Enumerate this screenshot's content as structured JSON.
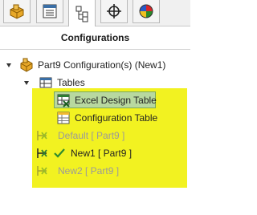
{
  "tabs": [
    {
      "name": "featuremanager-tab",
      "icon": "part-icon"
    },
    {
      "name": "propertymanager-tab",
      "icon": "property-list-icon"
    },
    {
      "name": "configurationmanager-tab",
      "icon": "configuration-tree-icon"
    },
    {
      "name": "dimxpertmanager-tab",
      "icon": "crosshair-icon"
    },
    {
      "name": "displaymanager-tab",
      "icon": "color-wheel-icon"
    }
  ],
  "panel": {
    "title": "Configurations"
  },
  "tree": {
    "root_label": "Part9 Configuration(s)  (New1)",
    "tables_label": "Tables",
    "excel_design_table": "Excel Design Table",
    "configuration_table": "Configuration Table",
    "configs": [
      {
        "label": "Default [ Part9 ]",
        "active": false
      },
      {
        "label": "New1 [ Part9 ]",
        "active": true
      },
      {
        "label": "New2 [ Part9 ]",
        "active": false
      }
    ]
  },
  "colors": {
    "highlight": "#f2f221",
    "selection": "#b8d8a0",
    "check": "#2e8b2e"
  }
}
